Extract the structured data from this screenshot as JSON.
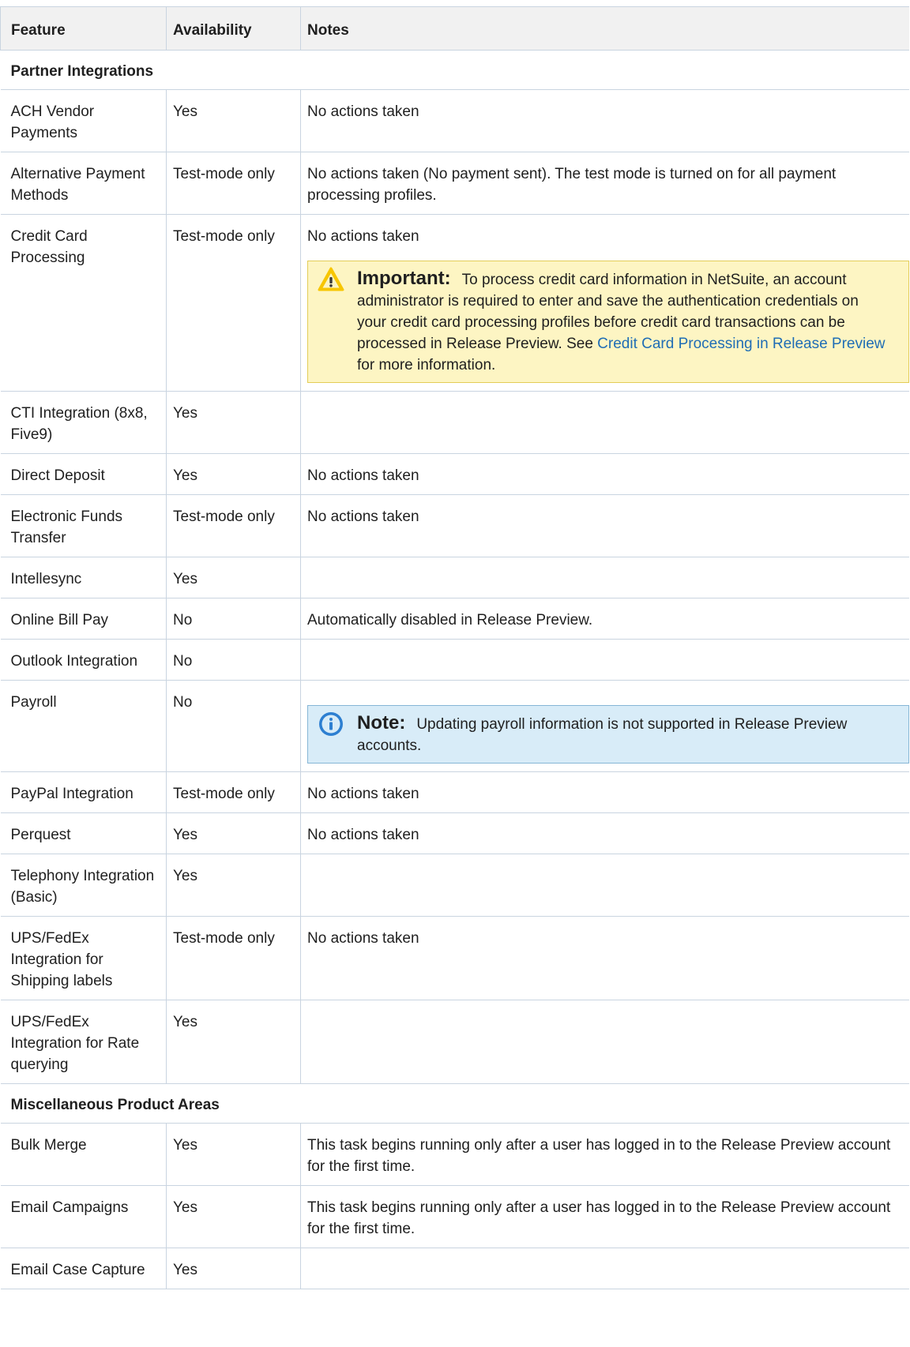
{
  "table": {
    "headers": [
      "Feature",
      "Availability",
      "Notes"
    ],
    "sections": [
      {
        "title": "Partner Integrations",
        "rows": [
          {
            "feature": "ACH Vendor Payments",
            "availability": "Yes",
            "notes": "No actions taken"
          },
          {
            "feature": "Alternative Payment Methods",
            "availability": "Test-mode only",
            "notes": "No actions taken (No payment sent). The test mode is turned on for all payment processing profiles."
          },
          {
            "feature": "Credit Card Processing",
            "availability": "Test-mode only",
            "notes": "No actions taken",
            "callout": {
              "type": "important",
              "icon": "warning-icon",
              "title": "Important:",
              "text_before": "To process credit card information in NetSuite, an account administrator is required to enter and save the authentication credentials on your credit card processing profiles before credit card transactions can be processed in Release Preview. See ",
              "link": "Credit Card Processing in Release Preview",
              "text_after": " for more information."
            }
          },
          {
            "feature": "CTI Integration (8x8, Five9)",
            "availability": "Yes",
            "notes": ""
          },
          {
            "feature": "Direct Deposit",
            "availability": "Yes",
            "notes": "No actions taken"
          },
          {
            "feature": "Electronic Funds Transfer",
            "availability": "Test-mode only",
            "notes": "No actions taken"
          },
          {
            "feature": "Intellesync",
            "availability": "Yes",
            "notes": ""
          },
          {
            "feature": "Online Bill Pay",
            "availability": "No",
            "notes": "Automatically disabled in Release Preview."
          },
          {
            "feature": "Outlook Integration",
            "availability": "No",
            "notes": ""
          },
          {
            "feature": "Payroll",
            "availability": "No",
            "notes": "",
            "callout": {
              "type": "note",
              "icon": "info-icon",
              "title": "Note:",
              "text_before": "Updating payroll information is not supported in Release Preview accounts.",
              "link": "",
              "text_after": ""
            }
          },
          {
            "feature": "PayPal Integration",
            "availability": "Test-mode only",
            "notes": "No actions taken"
          },
          {
            "feature": "Perquest",
            "availability": "Yes",
            "notes": "No actions taken"
          },
          {
            "feature": "Telephony Integration (Basic)",
            "availability": "Yes",
            "notes": ""
          },
          {
            "feature": "UPS/FedEx Integration for Shipping labels",
            "availability": "Test-mode only",
            "notes": "No actions taken"
          },
          {
            "feature": "UPS/FedEx Integration for Rate querying",
            "availability": "Yes",
            "notes": ""
          }
        ]
      },
      {
        "title": "Miscellaneous Product Areas",
        "rows": [
          {
            "feature": "Bulk Merge",
            "availability": "Yes",
            "notes": "This task begins running only after a user has logged in to the Release Preview account for the first time."
          },
          {
            "feature": "Email Campaigns",
            "availability": "Yes",
            "notes": "This task begins running only after a user has logged in to the Release Preview account for the first time."
          },
          {
            "feature": "Email Case Capture",
            "availability": "Yes",
            "notes": ""
          }
        ]
      }
    ]
  },
  "colors": {
    "important_bg": "#fdf5c3",
    "note_bg": "#d8ecf8",
    "border": "#c9d4e0",
    "link": "#1f6db5"
  }
}
